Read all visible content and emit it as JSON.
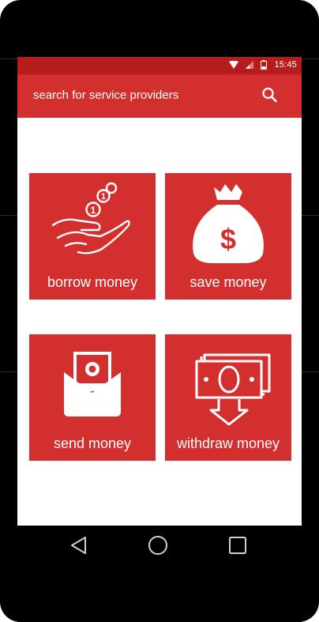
{
  "status_bar": {
    "time": "15:45",
    "icons": [
      "wifi-icon",
      "signal-icon",
      "battery-icon"
    ]
  },
  "app_bar": {
    "search_placeholder": "search for service providers",
    "search_icon": "search-icon"
  },
  "tiles": [
    {
      "label": "borrow money",
      "icon": "hand-coins-icon"
    },
    {
      "label": "save money",
      "icon": "money-bag-icon"
    },
    {
      "label": "send money",
      "icon": "envelope-money-icon"
    },
    {
      "label": "withdraw money",
      "icon": "banknote-withdraw-icon"
    }
  ],
  "nav_bar": {
    "buttons": [
      "back-icon",
      "home-icon",
      "recents-icon"
    ]
  },
  "colors": {
    "primary": "#d32f2f",
    "primary_dark": "#b71c1c",
    "on_primary": "#ffffff",
    "frame": "#000000"
  }
}
